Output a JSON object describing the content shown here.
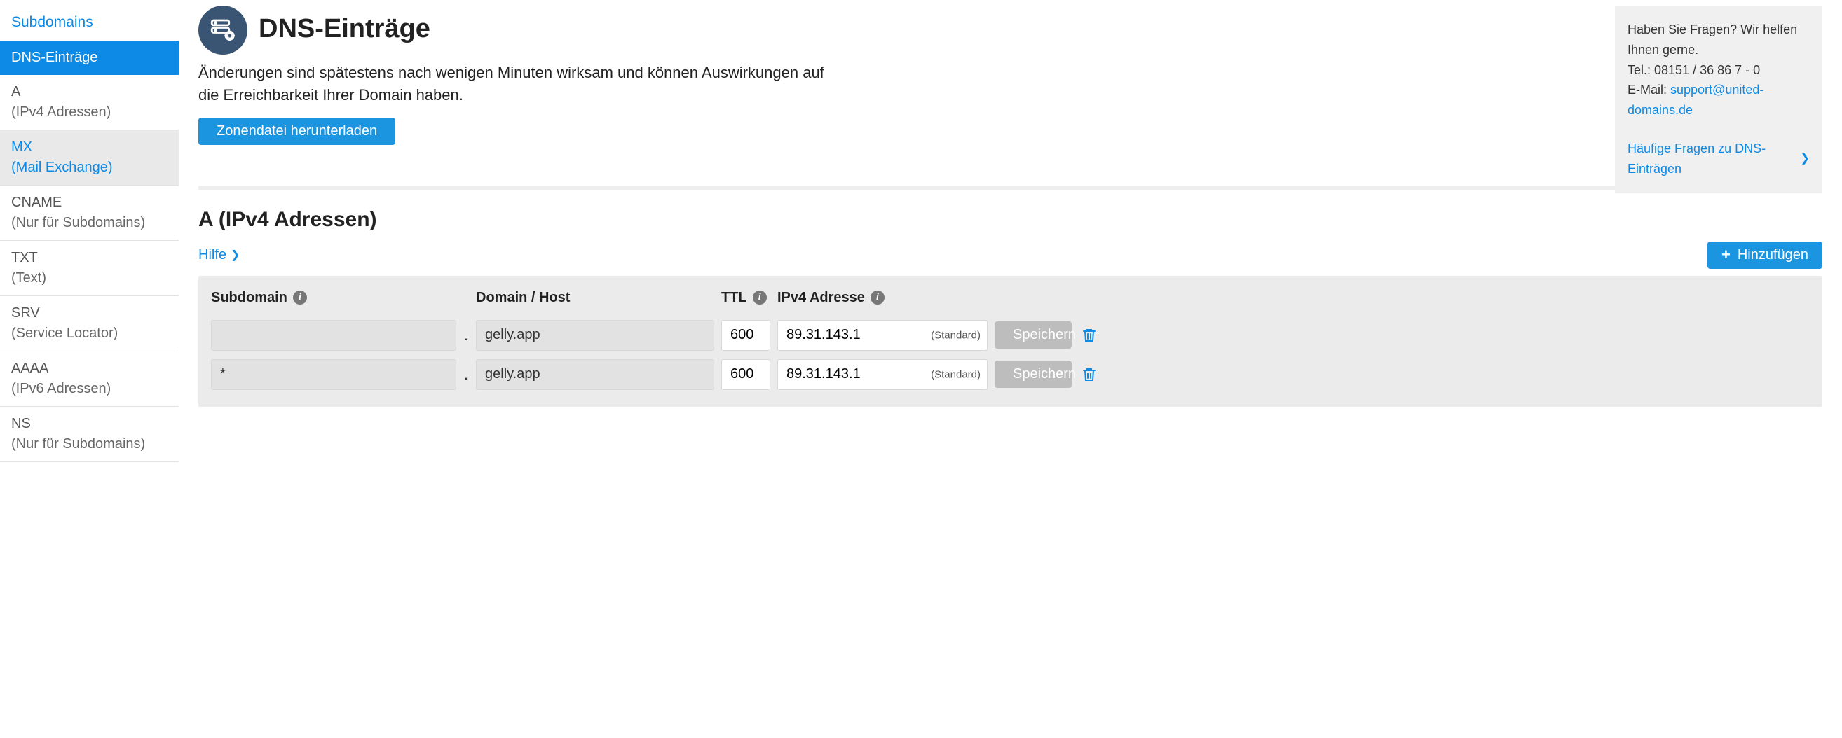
{
  "sidebar": {
    "top_link": "Subdomains",
    "items": [
      {
        "primary": "DNS-Einträge",
        "secondary": ""
      },
      {
        "primary": "A",
        "secondary": "(IPv4 Adressen)"
      },
      {
        "primary": "MX",
        "secondary": "(Mail Exchange)"
      },
      {
        "primary": "CNAME",
        "secondary": "(Nur für Subdomains)"
      },
      {
        "primary": "TXT",
        "secondary": "(Text)"
      },
      {
        "primary": "SRV",
        "secondary": "(Service Locator)"
      },
      {
        "primary": "AAAA",
        "secondary": "(IPv6 Adressen)"
      },
      {
        "primary": "NS",
        "secondary": "(Nur für Subdomains)"
      }
    ]
  },
  "header": {
    "title": "DNS-Einträge",
    "description": "Änderungen sind spätestens nach wenigen Minuten wirksam und können Auswirkungen auf die Erreichbarkeit Ihrer Domain haben.",
    "download_btn": "Zonendatei herunterladen"
  },
  "helpbox": {
    "intro": "Haben Sie Fragen? Wir helfen Ihnen gerne.",
    "tel_label": "Tel.: ",
    "tel_value": "08151 / 36 86 7 - 0",
    "email_label": "E-Mail: ",
    "email_value": "support@united-domains.de",
    "faq_link": "Häufige Fragen zu DNS-Einträgen"
  },
  "section_a": {
    "title": "A (IPv4 Adressen)",
    "help_link": "Hilfe",
    "add_btn": "Hinzufügen",
    "columns": {
      "subdomain": "Subdomain",
      "host": "Domain / Host",
      "ttl": "TTL",
      "ip": "IPv4 Adresse"
    },
    "standard_label": "(Standard)",
    "save_label": "Speichern",
    "rows": [
      {
        "subdomain": "",
        "host": "gelly.app",
        "ttl": "600",
        "ip": "89.31.143.1"
      },
      {
        "subdomain": "*",
        "host": "gelly.app",
        "ttl": "600",
        "ip": "89.31.143.1"
      }
    ]
  }
}
